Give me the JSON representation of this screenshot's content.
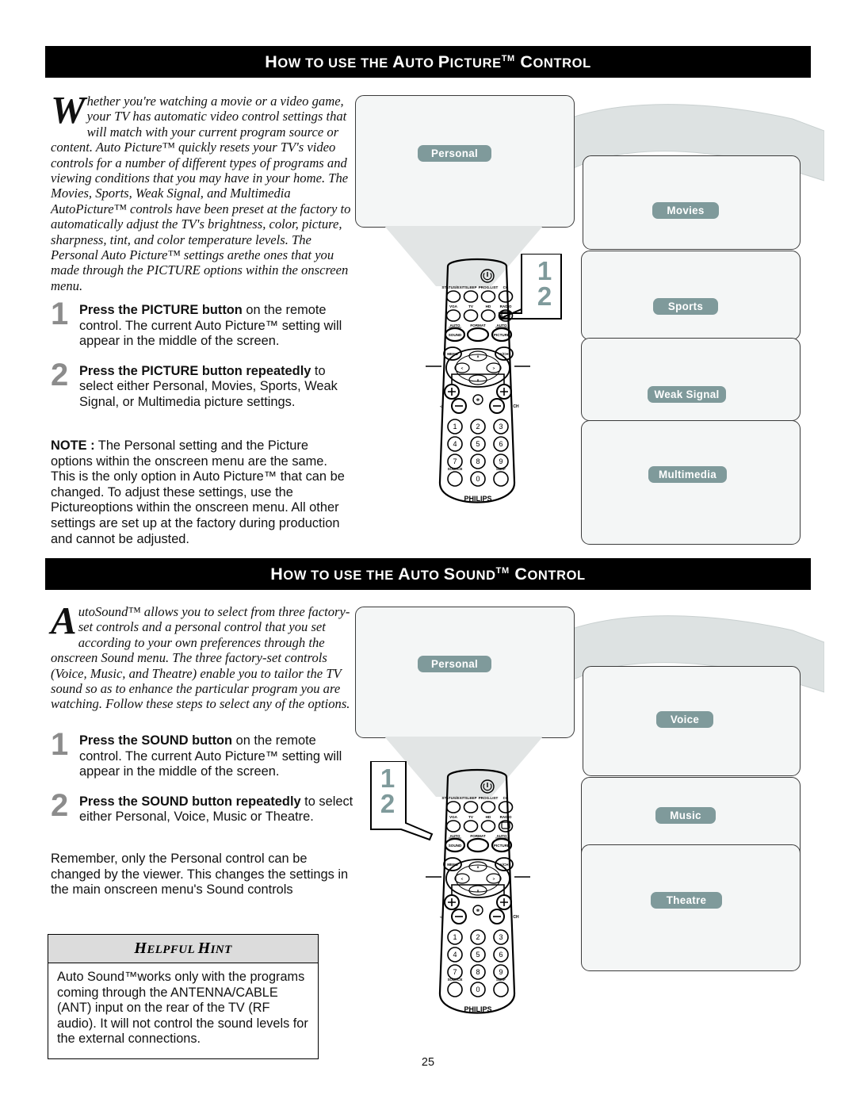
{
  "page": {
    "number": "25"
  },
  "section1": {
    "header": {
      "part1": "H",
      "part2": "OW TO USE THE ",
      "part3": "A",
      "part4": "UTO ",
      "part5": "P",
      "part6": "ICTURE",
      "tm": "TM",
      "part7": " C",
      "part8": "ONTROL",
      "plain": "How to use the Auto Picture™ Control"
    },
    "intro_dropcap": "W",
    "intro_text": "hether you're watching a movie or a video game, your TV has automatic video control settings that will match with your current program source or content. Auto Picture™ quickly resets your TV's video controls for a number of different types of programs and viewing conditions that you may have in your home. The Movies, Sports, Weak Signal, and Multimedia AutoPicture™ controls have been preset at the factory to automatically adjust the TV's brightness, color, picture, sharpness, tint, and color temperature levels.  The Personal Auto Picture™ settings arethe ones that you made through the PICTURE options within the onscreen menu.",
    "steps": [
      {
        "num": "1",
        "bold": "Press the PICTURE button",
        "rest": " on the remote control. The current Auto Picture™ setting will appear in the middle of the screen."
      },
      {
        "num": "2",
        "bold": "Press the PICTURE button repeatedly",
        "rest": " to select either Personal, Movies, Sports, Weak Signal, or Multimedia picture settings."
      }
    ],
    "note_label": "NOTE :",
    "note_text": " The Personal setting and the Picture options within the onscreen menu are the same. This is the only option in Auto Picture™ that can be changed. To adjust these settings, use the Pictureoptions within the onscreen menu. All other settings are set up at the factory during production and cannot be adjusted.",
    "diagram": {
      "personal_label": "Personal",
      "option_labels": [
        "Movies",
        "Sports",
        "Weak Signal",
        "Multimedia"
      ],
      "callout_numbers": [
        "1",
        "2"
      ],
      "remote_brand": "PHILIPS",
      "remote_buttons": {
        "row1": [
          "STATUS/EXIT",
          "SLEEP",
          "PROG.LIST",
          "CC"
        ],
        "row2": [
          "VGA",
          "TV",
          "HD",
          "RADIO"
        ],
        "row3": [
          "AUTO",
          "FORMAT",
          "AUTO"
        ],
        "row3_main": [
          "SOUND",
          "",
          "PICTURE"
        ],
        "nav": [
          "MENU",
          "A/CH"
        ],
        "sides": [
          "▵",
          "CH"
        ],
        "keypad": [
          "1",
          "2",
          "3",
          "4",
          "5",
          "6",
          "7",
          "8",
          "9",
          "0"
        ],
        "keypad_extra": [
          "SOURCE",
          "SURF"
        ]
      }
    }
  },
  "section2": {
    "header": {
      "part1": "H",
      "part2": "OW TO USE THE ",
      "part3": "A",
      "part4": "UTO ",
      "part5": "S",
      "part6": "OUND",
      "tm": "TM",
      "part7": " C",
      "part8": "ONTROL",
      "plain": "How to use the Auto Sound™ Control"
    },
    "intro_dropcap": "A",
    "intro_text": "utoSound™ allows you to select from three factory-set controls and a personal control that you set according to your own preferences through the onscreen Sound menu. The three factory-set controls (Voice, Music, and Theatre) enable you to tailor the TV sound so as to enhance the particular program you are watching. Follow these steps to select any of the options.",
    "steps": [
      {
        "num": "1",
        "bold": "Press the SOUND button",
        "rest": " on the remote control. The current Auto Picture™ setting will appear in the middle of the screen."
      },
      {
        "num": "2",
        "bold": "Press the SOUND button repeatedly",
        "rest": " to select either Personal, Voice, Music or Theatre."
      }
    ],
    "remember_text": "Remember, only the Personal control can be changed by the viewer.  This changes the settings in the main onscreen menu's Sound controls",
    "hint": {
      "title_h": "H",
      "title_rest1": "ELPFUL  ",
      "title_h2": "H",
      "title_rest2": "INT",
      "title_plain": "Helpful Hint",
      "body": "Auto Sound™works only with the programs coming through the ANTENNA/CABLE (ANT) input on the rear of the TV (RF audio).  It will not control the sound levels for the external connections."
    },
    "diagram": {
      "personal_label": "Personal",
      "option_labels": [
        "Voice",
        "Music",
        "Theatre"
      ],
      "callout_numbers": [
        "1",
        "2"
      ],
      "remote_brand": "PHILIPS"
    }
  },
  "colors": {
    "teal": "#7f9a9b",
    "box_fill": "#f4f6f6",
    "arrow_fill": "#dde2e2",
    "header_bar": "#000000",
    "step_number": "#8c8c8c",
    "hint_header": "#dcdcdc"
  }
}
